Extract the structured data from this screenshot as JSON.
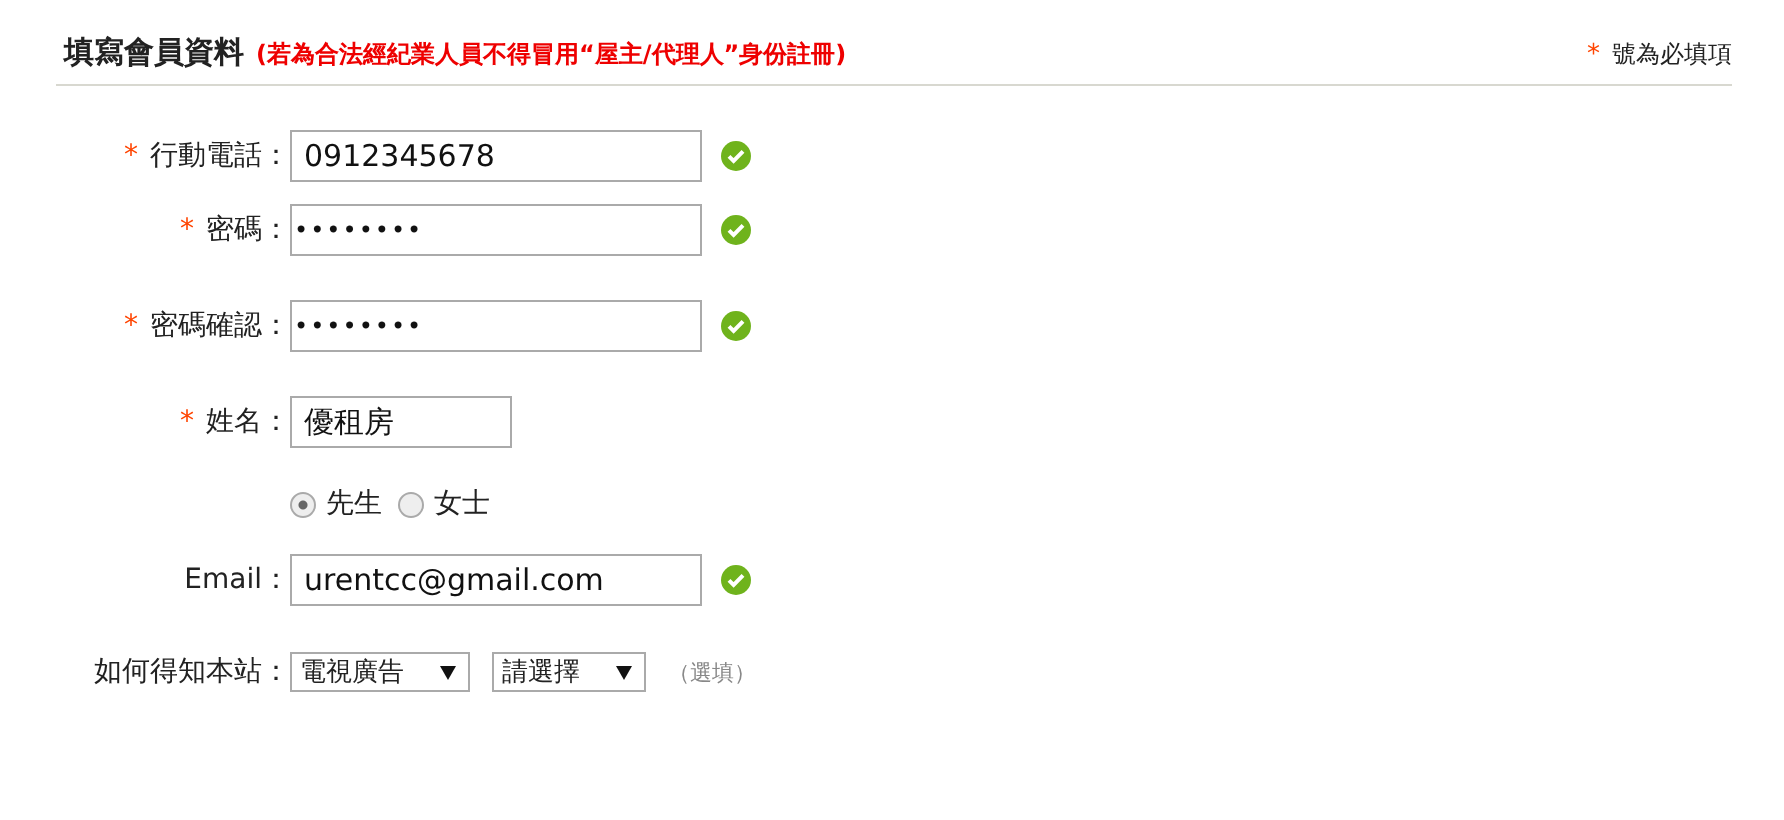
{
  "header": {
    "title": "填寫會員資料",
    "note": "(若為合法經紀業人員不得冒用“屋主/代理人”身份註冊)",
    "required_mark": "*",
    "required_text": "號為必填項"
  },
  "fields": [
    {
      "kind": "text",
      "required": true,
      "label": "行動電話：",
      "value": "0912345678",
      "valid": true
    },
    {
      "kind": "password",
      "required": true,
      "label": "密碼：",
      "value": "••••••••",
      "valid": true
    },
    {
      "kind": "password",
      "required": true,
      "label": "密碼確認：",
      "value": "••••••••",
      "valid": true
    },
    {
      "kind": "text",
      "required": true,
      "label": "姓名：",
      "value": "優租房",
      "valid": false
    },
    {
      "kind": "radio",
      "options": [
        {
          "label": "先生",
          "selected": true
        },
        {
          "label": "女士",
          "selected": false
        }
      ]
    },
    {
      "kind": "text",
      "required": false,
      "label": "Email：",
      "value": "urentcc@gmail.com",
      "valid": true
    },
    {
      "kind": "select",
      "required": false,
      "label": "如何得知本站：",
      "selects": [
        "電視廣告",
        "請選擇"
      ],
      "note": "（選填）"
    }
  ]
}
